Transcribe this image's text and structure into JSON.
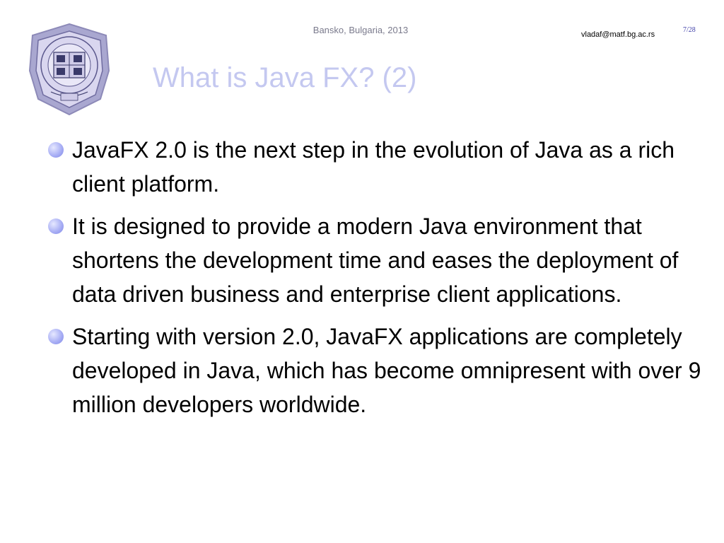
{
  "slide": {
    "logo": {
      "icon": "university-seal-icon",
      "colors": {
        "outer": "#a9a7d0",
        "inner": "#d9d6ef",
        "ink": "#3a3a6a"
      }
    },
    "header": {
      "center": "Bansko, Bulgaria, 2013",
      "email": "vladaf@matf.bg.ac.rs",
      "page": "7/28"
    },
    "title": "What is Java FX? (2)",
    "bullets": [
      {
        "text": "JavaFX 2.0 is the next step in the evolution of Java as a rich client platform."
      },
      {
        "text": "It is designed to provide a modern Java environment that shortens the development time and eases the deployment of data driven business and enterprise client applications."
      },
      {
        "text": "Starting with version 2.0, JavaFX applications are completely developed in Java, which has become omnipresent with over 9 million developers worldwide."
      }
    ],
    "colors": {
      "title": "#c4c8f0",
      "bullet": "#aab0f5",
      "header": "#7a7a8c",
      "page_number": "#3e3ea8"
    }
  }
}
